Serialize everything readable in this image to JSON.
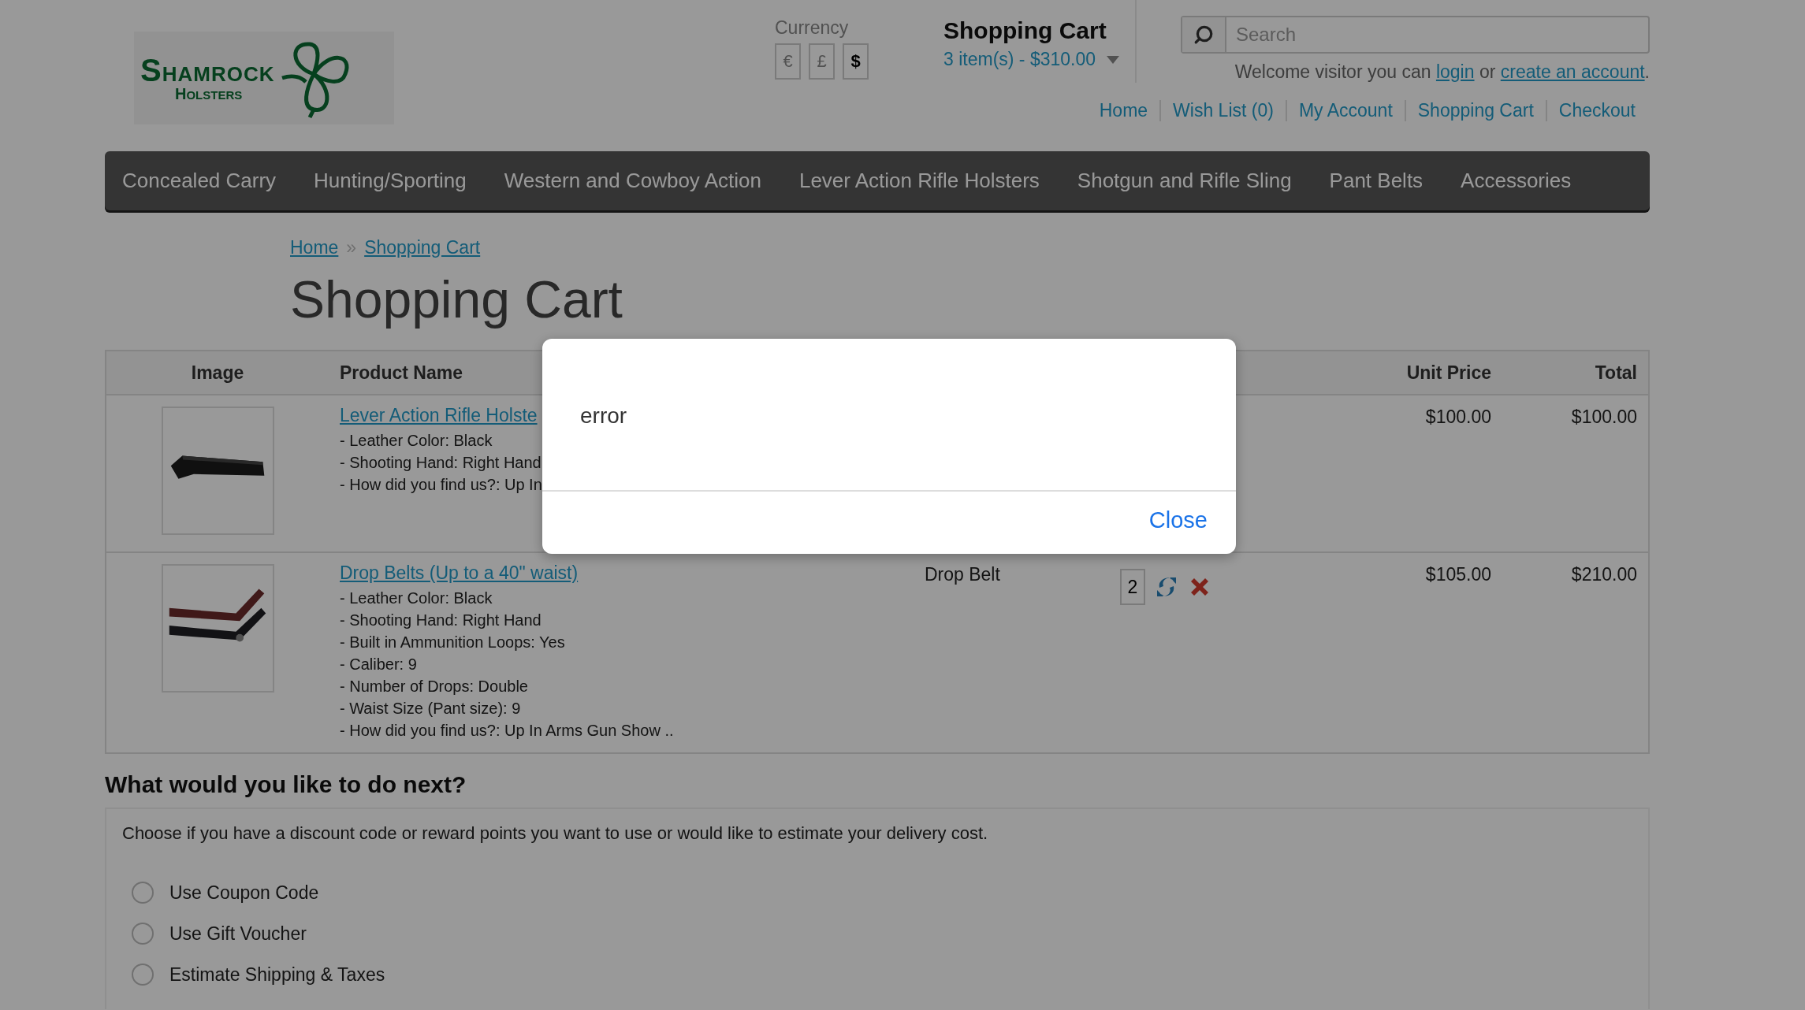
{
  "logo": {
    "name": "SHAMROCK",
    "tagline": "HOLSTERS"
  },
  "currency": {
    "label": "Currency",
    "options": [
      {
        "symbol": "€",
        "selected": false
      },
      {
        "symbol": "£",
        "selected": false
      },
      {
        "symbol": "$",
        "selected": true
      }
    ]
  },
  "cart_summary": {
    "title": "Shopping Cart",
    "total": "3 item(s) - $310.00"
  },
  "search": {
    "placeholder": "Search"
  },
  "welcome": {
    "before": "Welcome visitor you can",
    "login": "login",
    "middle": "or",
    "register": "create an account",
    "after": "."
  },
  "top_links": [
    "Home",
    "Wish List (0)",
    "My Account",
    "Shopping Cart",
    "Checkout"
  ],
  "nav": [
    "Concealed Carry",
    "Hunting/Sporting",
    "Western and Cowboy Action",
    "Lever Action Rifle Holsters",
    "Shotgun and Rifle Sling",
    "Pant Belts",
    "Accessories"
  ],
  "breadcrumb": {
    "separator": "»",
    "links": [
      "Home",
      "Shopping Cart"
    ]
  },
  "page_title": "Shopping Cart",
  "table": {
    "columns": [
      "Image",
      "Product Name",
      "Unit Price",
      "Total"
    ],
    "rows": [
      {
        "name": "Lever Action Rifle Holste",
        "options": [
          "- Leather Color: Black",
          "- Shooting Hand: Right Hand",
          "- How did you find us?: Up In"
        ],
        "unit_price": "$100.00",
        "total": "$100.00",
        "picture": {
          "kind": "picture"
        }
      },
      {
        "name": "Drop Belts (Up to a 40\" waist)",
        "options": [
          "- Leather Color: Black",
          "- Shooting Hand: Right Hand",
          "- Built in Ammunition Loops: Yes",
          "- Caliber: 9",
          "- Number of Drops: Double",
          "- Waist Size (Pant size): 9",
          "- How did you find us?: Up In Arms Gun Show .."
        ],
        "model": "Drop Belt",
        "quantity": "2",
        "unit_price": "$105.00",
        "total": "$210.00",
        "picture": {
          "kind": "picture"
        }
      }
    ]
  },
  "next": {
    "title": "What would you like to do next?",
    "text": "Choose if you have a discount code or reward points you want to use or would like to estimate your delivery cost.",
    "options": [
      {
        "label": "Use Coupon Code",
        "selected": false
      },
      {
        "label": "Use Gift Voucher",
        "selected": false
      },
      {
        "label": "Estimate Shipping & Taxes",
        "selected": false
      }
    ]
  },
  "dialog": {
    "message": "error",
    "button": "Close"
  }
}
